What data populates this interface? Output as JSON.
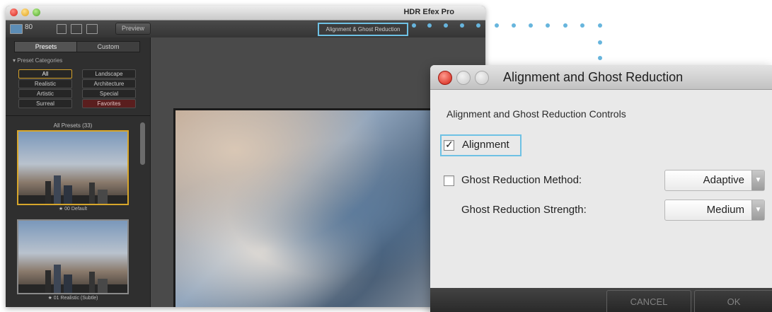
{
  "app": {
    "title": "HDR Efex Pro",
    "toolbar": {
      "view_count": "80",
      "preview_label": "Preview",
      "alignment_button_label": "Alignment & Ghost Reduction"
    }
  },
  "sidebar": {
    "tabs": [
      {
        "label": "Presets",
        "active": true
      },
      {
        "label": "Custom",
        "active": false
      }
    ],
    "category_header": "▾  Preset Categories",
    "categories": [
      {
        "label": "All",
        "selected": true
      },
      {
        "label": "Landscape"
      },
      {
        "label": "Realistic"
      },
      {
        "label": "Architecture"
      },
      {
        "label": "Artistic"
      },
      {
        "label": "Special"
      },
      {
        "label": "Surreal"
      },
      {
        "label": "Favorites"
      }
    ],
    "list_title": "All Presets (33)",
    "presets": [
      {
        "label": "★ 00 Default",
        "selected": true
      },
      {
        "label": "★ 01 Realistic (Subtle)"
      }
    ]
  },
  "dialog": {
    "title": "Alignment and Ghost Reduction",
    "heading": "Alignment and Ghost Reduction Controls",
    "alignment": {
      "label": "Alignment",
      "checked": true,
      "check_glyph": "✓"
    },
    "ghost_method": {
      "label": "Ghost Reduction Method:",
      "checked": false,
      "value": "Adaptive"
    },
    "ghost_strength": {
      "label": "Ghost Reduction Strength:",
      "value": "Medium"
    },
    "cancel_label": "CANCEL",
    "ok_label": "OK"
  },
  "colors": {
    "highlight": "#6ec1e4",
    "selected_preset_border": "#d7a62b"
  }
}
